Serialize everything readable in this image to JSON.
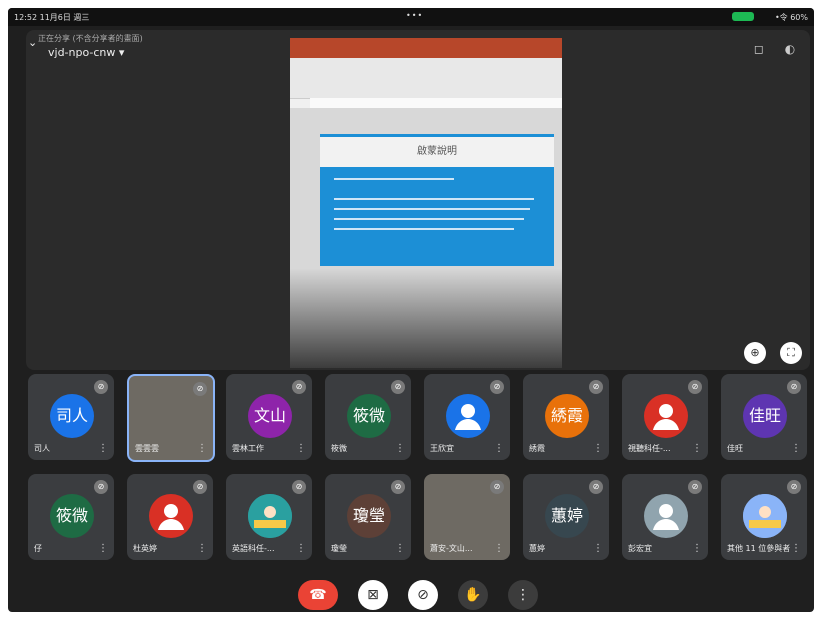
{
  "status": {
    "time": "12:52 11月6日 週三",
    "dots": "•••",
    "battery": "•令 60%"
  },
  "meeting": {
    "subtitle": "正在分享 (不含分享者的畫面)",
    "code": "vjd-npo-cnw ▾"
  },
  "top_icons": [
    "camera-switch-icon",
    "speaker-icon"
  ],
  "slide": {
    "title": "啟蒙說明"
  },
  "stage_buttons": [
    "pin-icon",
    "fullscreen-icon"
  ],
  "tiles": [
    {
      "avatar_text": "司人",
      "name": "司人",
      "color": "#1a73e8"
    },
    {
      "avatar_text": "",
      "name": "雲雲雲",
      "color": "#6e6a63",
      "video": true,
      "selected": true
    },
    {
      "avatar_text": "文山",
      "name": "雲林工作",
      "color": "#8e24aa"
    },
    {
      "avatar_text": "筱微",
      "name": "筱微",
      "color": "#1e6b44"
    },
    {
      "avatar_text": "",
      "name": "王欣宜",
      "color": "#1a73e8",
      "person": true
    },
    {
      "avatar_text": "綉霞",
      "name": "綉霞",
      "color": "#e8710a"
    },
    {
      "avatar_text": "",
      "name": "視聽科任-...",
      "color": "#d93025",
      "person": true
    },
    {
      "avatar_text": "佳旺",
      "name": "佳旺",
      "color": "#5e35b1"
    },
    {
      "avatar_text": "筱微",
      "name": "仔",
      "color": "#1e6b44"
    },
    {
      "avatar_text": "",
      "name": "杜英婷",
      "color": "#d93025",
      "person": true
    },
    {
      "avatar_text": "",
      "name": "英語科任-...",
      "color": "#2aa0a0",
      "photo": true
    },
    {
      "avatar_text": "瓊瑩",
      "name": "瓊瑩",
      "color": "#5d4037"
    },
    {
      "avatar_text": "",
      "name": "蕭安-文山...",
      "color": "#6e6a63",
      "video": true
    },
    {
      "avatar_text": "蕙婷",
      "name": "蕙婷",
      "color": "#37474f"
    },
    {
      "avatar_text": "",
      "name": "彭宏宜",
      "color": "#90a4ae",
      "person": true
    },
    {
      "avatar_text": "",
      "name": "其他 11 位參與者",
      "color": "#8ab4f8",
      "photo": true
    }
  ],
  "controls": [
    "end-call-icon",
    "camera-off-icon",
    "mic-off-icon",
    "raise-hand-icon",
    "more-icon"
  ]
}
